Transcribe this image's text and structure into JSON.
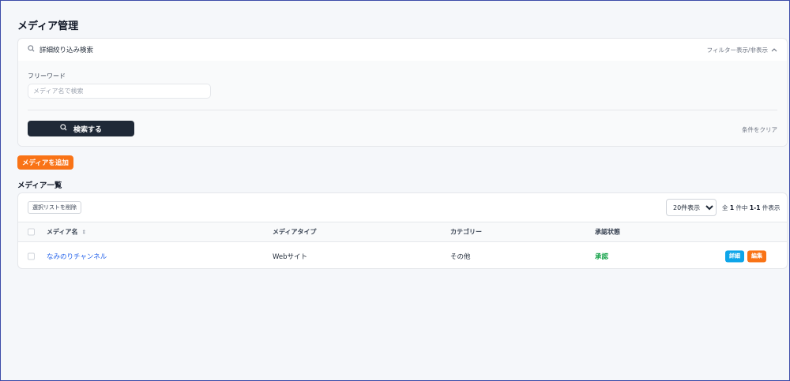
{
  "page": {
    "title": "メディア管理"
  },
  "filter": {
    "header_label": "詳細絞り込み検索",
    "toggle_label": "フィルター表示/非表示",
    "keyword_label": "フリーワード",
    "keyword_placeholder": "メディア名で検索",
    "keyword_value": "",
    "search_button_label": "検索する",
    "clear_label": "条件をクリア"
  },
  "add_button_label": "メディアを追加",
  "list": {
    "title": "メディア一覧",
    "bulk_delete_label": "選択リストを削除",
    "per_page_selected": "20件表示",
    "summary": {
      "prefix": "全",
      "total": "1",
      "middle": "件中",
      "range": "1-1",
      "suffix": "件表示"
    },
    "columns": [
      "メディア名",
      "メディアタイプ",
      "カテゴリー",
      "承認状態"
    ],
    "rows": [
      {
        "name": "なみのりチャンネル",
        "type": "Webサイト",
        "category": "その他",
        "status": "承認",
        "detail_label": "詳細",
        "edit_label": "編集"
      }
    ]
  },
  "colors": {
    "accent": "#f97316",
    "primary_dark": "#1f2937",
    "link": "#2563eb",
    "approved": "#16a34a",
    "detail": "#0ea5e9"
  },
  "icons": {
    "search": "search-icon",
    "chevron": "chevron-up-icon",
    "sort": "sort-icon"
  }
}
